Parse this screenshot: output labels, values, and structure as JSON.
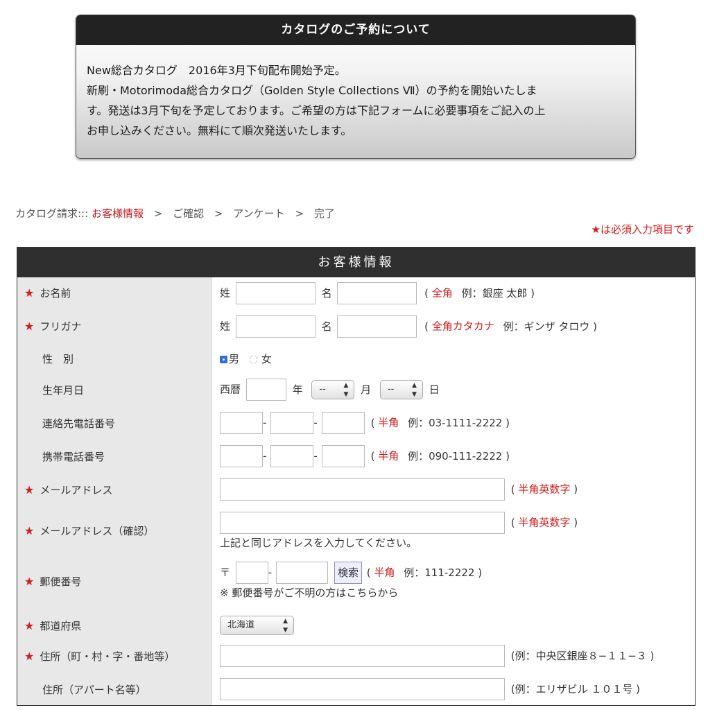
{
  "notice": {
    "title": "カタログのご予約について",
    "line1": "New総合カタログ　2016年3月下旬配布開始予定。",
    "line2": "新刷・Motorimoda総合カタログ（Golden Style Collections Ⅶ）の予約を開始いたしま",
    "line3": "す。発送は3月下旬を予定しております。ご希望の方は下記フォームに必要事項をご記入の上",
    "line4": "お申し込みください。無料にて順次発送いたします。"
  },
  "steps": {
    "prefix": "カタログ請求:::",
    "items": [
      "お客様情報",
      "ご確認",
      "アンケート",
      "完了"
    ],
    "separator": ">"
  },
  "required_note": "★は必須入力項目です",
  "form": {
    "title": "お客様情報",
    "required_mark": "★",
    "name": {
      "label": "お名前",
      "sei": "姓",
      "mei": "名",
      "hint_open": "(",
      "hint_red": "全角",
      "hint_rest": "例：銀座 太郎 )"
    },
    "kana": {
      "label": "フリガナ",
      "sei": "姓",
      "mei": "名",
      "hint_open": "(",
      "hint_red": "全角カタカナ",
      "hint_rest": "例：ギンザ タロウ )"
    },
    "gender": {
      "label": "性　別",
      "male": "男",
      "female": "女",
      "selected": "男"
    },
    "birthday": {
      "label": "生年月日",
      "era": "西暦",
      "year": "年",
      "month_value": "--",
      "month": "月",
      "day_value": "--",
      "day": "日"
    },
    "phone": {
      "label": "連絡先電話番号",
      "dash": "-",
      "hint_open": "(",
      "hint_red": "半角",
      "hint_rest": "例：03-1111-2222 )"
    },
    "mobile": {
      "label": "携帯電話番号",
      "dash": "-",
      "hint_open": "(",
      "hint_red": "半角",
      "hint_rest": "例：090-111-2222 )"
    },
    "email": {
      "label": "メールアドレス",
      "hint_open": "(",
      "hint_red": "半角英数字",
      "hint_close": ")"
    },
    "email_confirm": {
      "label": "メールアドレス（確認）",
      "hint_open": "(",
      "hint_red": "半角英数字",
      "hint_close": ")",
      "note": "上記と同じアドレスを入力してください。"
    },
    "postal": {
      "label": "郵便番号",
      "mark": "〒",
      "dash": "-",
      "search_button": "検索",
      "hint_open": "(",
      "hint_red": "半角",
      "hint_rest": "例：111-2222 )",
      "note": "※ 郵便番号がご不明の方はこちらから"
    },
    "prefecture": {
      "label": "都道府県",
      "value": "北海道"
    },
    "address1": {
      "label": "住所（町・村・字・番地等）",
      "hint": "(例：中央区銀座８−１１−３ )"
    },
    "address2": {
      "label": "住所（アパート名等）",
      "hint": "(例：エリザビル １０１号 )"
    }
  }
}
